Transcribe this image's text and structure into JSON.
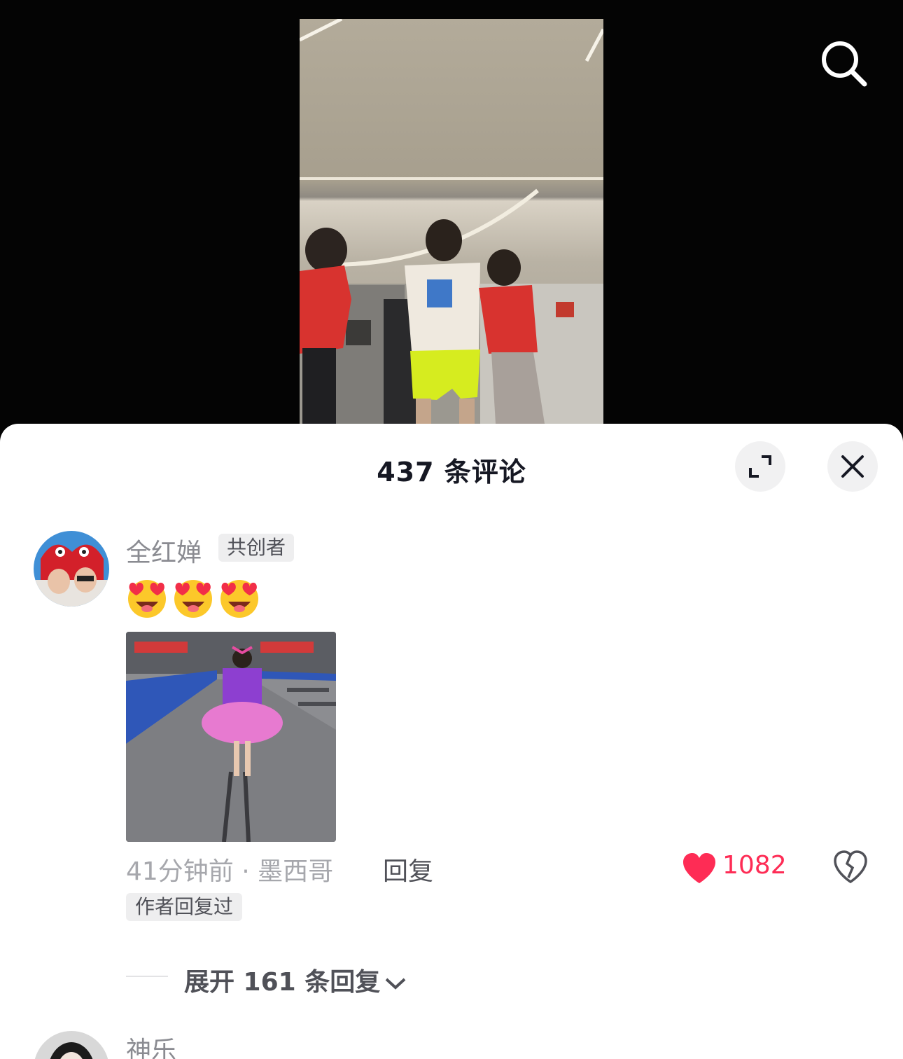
{
  "video": {
    "search_icon": "search-icon"
  },
  "sheet": {
    "title": "437 条评论",
    "expand_icon": "expand-icon",
    "close_icon": "close-icon"
  },
  "comments": [
    {
      "username": "全红婵",
      "tag": "共创者",
      "emojis": [
        "heart-eyes-emoji",
        "heart-eyes-emoji",
        "heart-eyes-emoji"
      ],
      "image": "comment-image-tutu-dancer",
      "meta": "41分钟前 · 墨西哥",
      "reply_label": "回复",
      "like_count": "1082",
      "liked": true,
      "author_replied": "作者回复过",
      "expand_replies": "展开 161 条回复"
    },
    {
      "username": "神乐"
    }
  ],
  "colors": {
    "accent": "#fe2c55",
    "title": "#161823",
    "secondary_text": "#8a8b91",
    "sheet_bg": "#ffffff"
  }
}
